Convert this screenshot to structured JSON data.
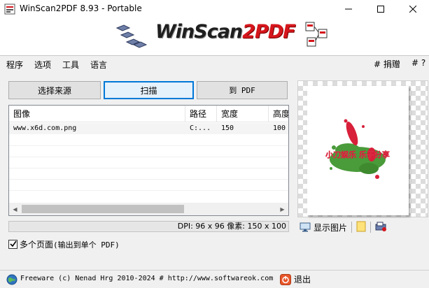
{
  "window": {
    "title": "WinScan2PDF 8.93 - Portable"
  },
  "banner": {
    "logo_part1": "WinScan",
    "logo_part2": "2",
    "logo_part3": "PDF"
  },
  "menu": {
    "items": [
      "程序",
      "选项",
      "工具",
      "语言"
    ],
    "right_donate": "# 捐赠",
    "right_help": "# ?"
  },
  "toolbar": {
    "select_source": "选择来源",
    "scan": "扫描",
    "to_pdf": "到 PDF"
  },
  "list": {
    "columns": [
      "图像",
      "路径",
      "宽度",
      "高度"
    ],
    "rows": [
      {
        "image": "www.x6d.com.png",
        "path": "C:...",
        "width": "150",
        "height": "100"
      }
    ]
  },
  "status": {
    "dpi_text": "DPI: 96 x 96 像素: 150 x 100"
  },
  "options": {
    "multipage_label": "多个页面",
    "multipage_hint": "(输出到单个 PDF)",
    "multipage_checked": true
  },
  "preview": {
    "image_text": "小刀娱乐 乐于分享",
    "show_image_label": "显示图片"
  },
  "footer": {
    "copyright": "Freeware (c) Nenad Hrg 2010-2024 # http://www.softwareok.com",
    "exit_label": "退出"
  },
  "colors": {
    "accent": "#0078d7",
    "logo_red": "#d5161c",
    "splash_green": "#4a9b3a",
    "splash_red": "#d8203a"
  }
}
